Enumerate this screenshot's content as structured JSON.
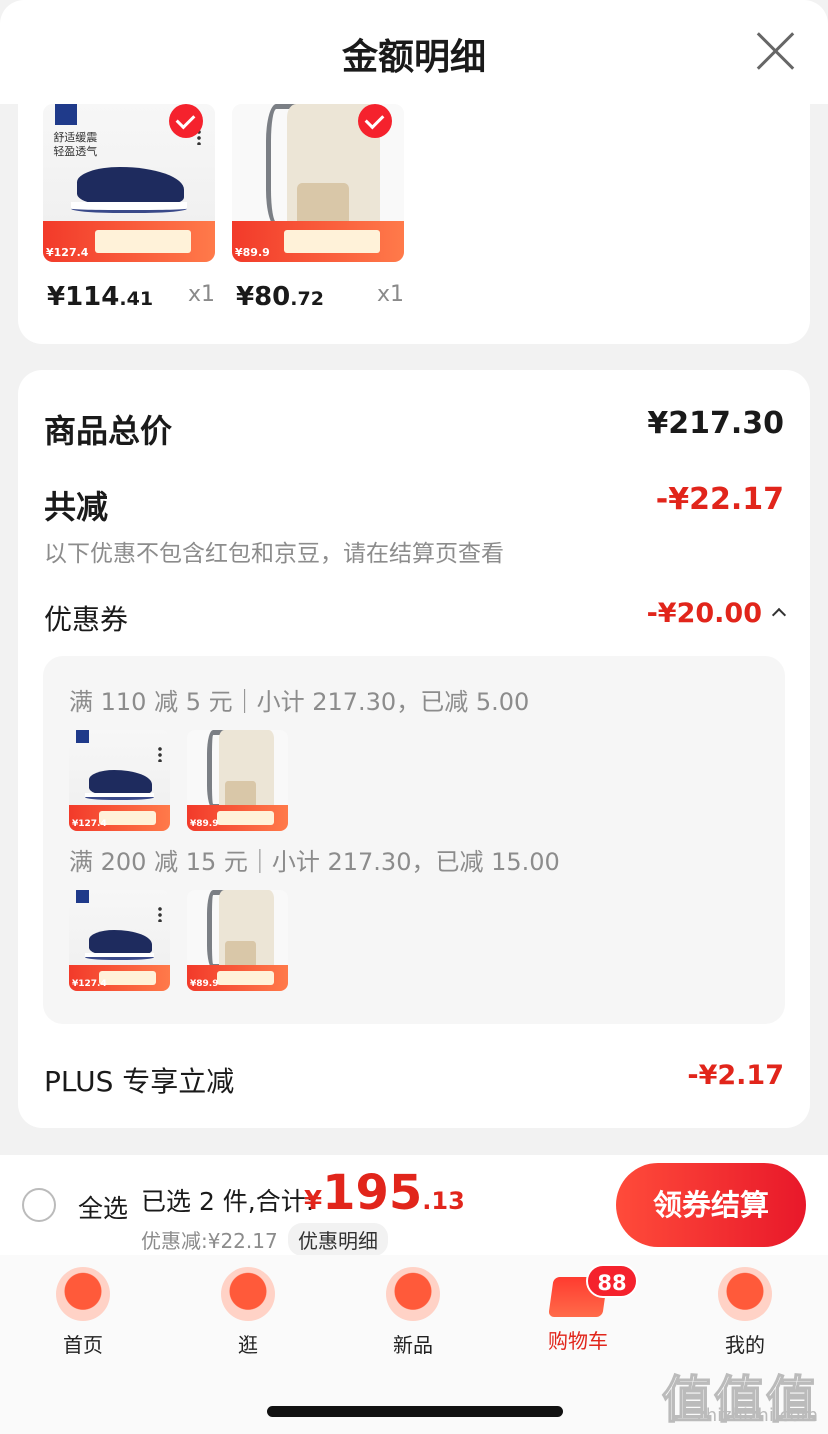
{
  "header": {
    "title": "金额明细"
  },
  "products": [
    {
      "price_int": "¥114",
      "price_dec": ".41",
      "qty": "x1",
      "badge_price": "¥127.4",
      "kind": "shoe",
      "brand_lines": [
        "舒适缓震",
        "轻盈透气"
      ]
    },
    {
      "price_int": "¥80",
      "price_dec": ".72",
      "qty": "x1",
      "badge_price": "¥89.9",
      "kind": "bag"
    }
  ],
  "summary": {
    "total_label": "商品总价",
    "total_value": "¥217.30",
    "reduce_label": "共减",
    "reduce_value": "-¥22.17",
    "reduce_note": "以下优惠不包含红包和京豆，请在结算页查看",
    "coupon_label": "优惠券",
    "coupon_value": "-¥20.00",
    "coupon_rules": [
      {
        "text": "满 110 减 5 元｜小计 217.30，已减 5.00"
      },
      {
        "text": "满 200 减 15 元｜小计 217.30，已减 15.00"
      }
    ],
    "plus_label": "PLUS 专享立减",
    "plus_value": "-¥2.17"
  },
  "checkout": {
    "select_all": "全选",
    "selected_text": "已选 2 件,合计:",
    "total_symbol": "¥",
    "total_int": "195",
    "total_dec": ".13",
    "discount_text": "优惠减:¥22.17",
    "discount_link": "优惠明细",
    "button": "领券结算"
  },
  "tabbar": {
    "items": [
      {
        "label": "首页",
        "icon": "home-icon"
      },
      {
        "label": "逛",
        "icon": "explore-icon"
      },
      {
        "label": "新品",
        "icon": "new-product-icon"
      },
      {
        "label": "购物车",
        "icon": "cart-icon",
        "active": true
      },
      {
        "label": "我的",
        "icon": "profile-icon"
      }
    ],
    "cart_badge": "88"
  },
  "watermark": {
    "logo": "值值值",
    "url": "zhizhizhi.com"
  },
  "colors": {
    "accent": "#e1251b",
    "background": "#f2f2f2"
  }
}
